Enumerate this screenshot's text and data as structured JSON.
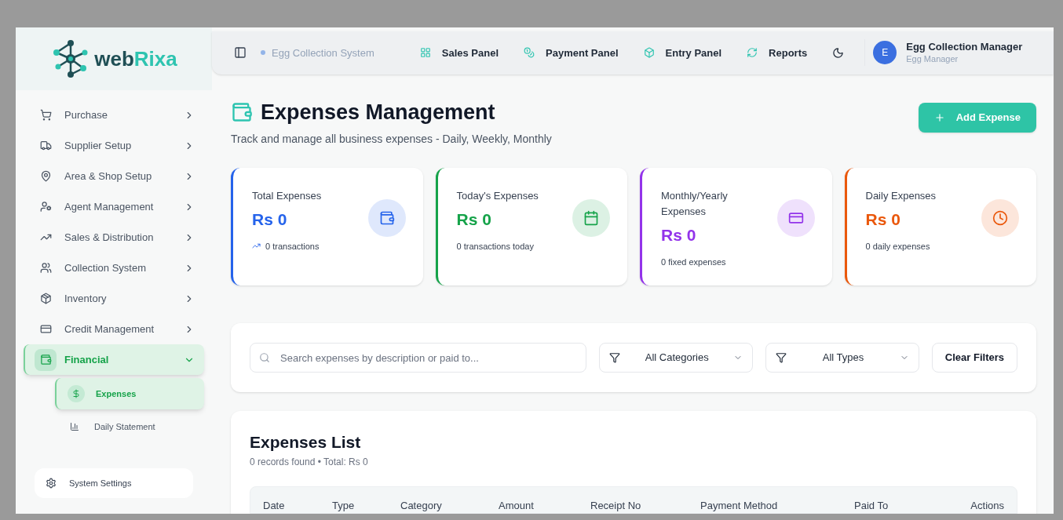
{
  "brand": {
    "name_start": "web",
    "name_end": "Rixa"
  },
  "sidebar": {
    "items": [
      {
        "label": "Purchase",
        "kind": "cart",
        "expanded": false,
        "selected": false
      },
      {
        "label": "Supplier Setup",
        "kind": "truck",
        "expanded": false,
        "selected": false
      },
      {
        "label": "Area & Shop Setup",
        "kind": "pin",
        "expanded": false,
        "selected": false
      },
      {
        "label": "Agent Management",
        "kind": "user",
        "expanded": false,
        "selected": false
      },
      {
        "label": "Sales & Distribution",
        "kind": "trend",
        "expanded": false,
        "selected": false
      },
      {
        "label": "Collection System",
        "kind": "users",
        "expanded": false,
        "selected": false
      },
      {
        "label": "Inventory",
        "kind": "package",
        "expanded": false,
        "selected": false
      },
      {
        "label": "Credit Management",
        "kind": "card",
        "expanded": false,
        "selected": false
      },
      {
        "label": "Financial",
        "kind": "wallet",
        "expanded": true,
        "selected": true,
        "children": [
          {
            "label": "Expenses",
            "kind": "dollar",
            "selected": true
          },
          {
            "label": "Daily Statement",
            "kind": "chart",
            "selected": false
          }
        ]
      }
    ],
    "footer": {
      "label": "System Settings"
    }
  },
  "header": {
    "system": "Egg Collection System",
    "links": [
      {
        "label": "Sales Panel",
        "kind": "grid"
      },
      {
        "label": "Payment Panel",
        "kind": "coins"
      },
      {
        "label": "Entry Panel",
        "kind": "box"
      },
      {
        "label": "Reports",
        "kind": "refresh"
      }
    ],
    "user": {
      "initial": "E",
      "name": "Egg Collection Manager",
      "role": "Egg Manager"
    }
  },
  "page": {
    "title": "Expenses Management",
    "subtitle": "Track and manage all business expenses - Daily, Weekly, Monthly",
    "add_button": "Add Expense"
  },
  "stats": [
    {
      "title": "Total Expenses",
      "value": "Rs 0",
      "note": "0 transactions",
      "kind": "wallet",
      "color": "#2563eb",
      "trend": true
    },
    {
      "title": "Today's Expenses",
      "value": "Rs 0",
      "note": "0 transactions today",
      "kind": "calendar",
      "color": "#16a34a",
      "trend": false
    },
    {
      "title": "Monthly/Yearly Expenses",
      "value": "Rs 0",
      "note": "0 fixed expenses",
      "kind": "card",
      "color": "#9333ea",
      "trend": false
    },
    {
      "title": "Daily Expenses",
      "value": "Rs 0",
      "note": "0 daily expenses",
      "kind": "clock",
      "color": "#ea580c",
      "trend": false
    }
  ],
  "filters": {
    "search_placeholder": "Search expenses by description or paid to...",
    "category": "All Categories",
    "type": "All Types",
    "clear": "Clear Filters"
  },
  "list": {
    "title": "Expenses List",
    "summary": "0 records found • Total: Rs 0",
    "columns": [
      "Date",
      "Type",
      "Category",
      "Amount",
      "Receipt No",
      "Payment Method",
      "Paid To",
      "Actions"
    ]
  }
}
